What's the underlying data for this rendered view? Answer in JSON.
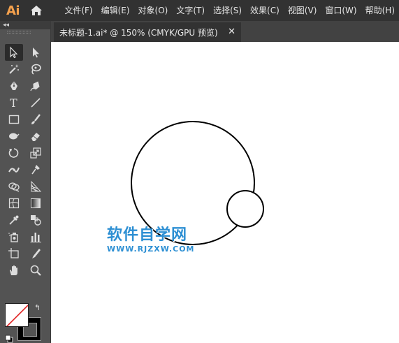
{
  "app": {
    "logo": "Ai"
  },
  "menu": {
    "items": [
      "文件(F)",
      "编辑(E)",
      "对象(O)",
      "文字(T)",
      "选择(S)",
      "效果(C)",
      "视图(V)",
      "窗口(W)",
      "帮助(H)"
    ]
  },
  "toolbar": {
    "collapse": "◂◂",
    "tools": [
      "selection-tool",
      "direct-selection-tool",
      "magic-wand-tool",
      "lasso-tool",
      "pen-tool",
      "curvature-tool",
      "type-tool",
      "line-segment-tool",
      "rectangle-tool",
      "paintbrush-tool",
      "shaper-tool",
      "eraser-tool",
      "rotate-tool",
      "scale-tool",
      "width-tool",
      "puppet-warp-tool",
      "shape-builder-tool",
      "perspective-grid-tool",
      "mesh-tool",
      "gradient-tool",
      "eyedropper-tool",
      "blend-tool",
      "symbol-sprayer-tool",
      "column-graph-tool",
      "artboard-tool",
      "slice-tool",
      "hand-tool",
      "zoom-tool"
    ],
    "swap_glyph": "↰"
  },
  "document": {
    "tab_title": "未标题-1.ai* @ 150% (CMYK/GPU 预览)",
    "close_glyph": "✕"
  },
  "watermark": {
    "title": "软件自学网",
    "url": "WWW.RJZXW.COM"
  },
  "colors": {
    "menubar": "#323232",
    "panel": "#535353",
    "logo": "#f4a14d",
    "watermark": "#2d8fd3"
  }
}
